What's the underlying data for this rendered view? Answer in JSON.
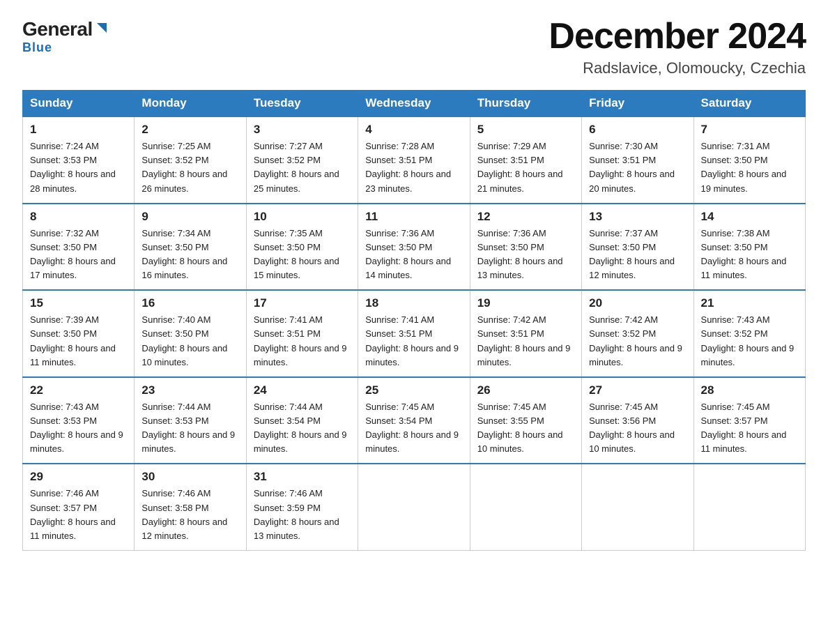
{
  "header": {
    "logo_general": "General",
    "logo_blue": "Blue",
    "month_title": "December 2024",
    "location": "Radslavice, Olomoucky, Czechia"
  },
  "days_of_week": [
    "Sunday",
    "Monday",
    "Tuesday",
    "Wednesday",
    "Thursday",
    "Friday",
    "Saturday"
  ],
  "weeks": [
    [
      {
        "day": "1",
        "sunrise": "7:24 AM",
        "sunset": "3:53 PM",
        "daylight": "8 hours and 28 minutes."
      },
      {
        "day": "2",
        "sunrise": "7:25 AM",
        "sunset": "3:52 PM",
        "daylight": "8 hours and 26 minutes."
      },
      {
        "day": "3",
        "sunrise": "7:27 AM",
        "sunset": "3:52 PM",
        "daylight": "8 hours and 25 minutes."
      },
      {
        "day": "4",
        "sunrise": "7:28 AM",
        "sunset": "3:51 PM",
        "daylight": "8 hours and 23 minutes."
      },
      {
        "day": "5",
        "sunrise": "7:29 AM",
        "sunset": "3:51 PM",
        "daylight": "8 hours and 21 minutes."
      },
      {
        "day": "6",
        "sunrise": "7:30 AM",
        "sunset": "3:51 PM",
        "daylight": "8 hours and 20 minutes."
      },
      {
        "day": "7",
        "sunrise": "7:31 AM",
        "sunset": "3:50 PM",
        "daylight": "8 hours and 19 minutes."
      }
    ],
    [
      {
        "day": "8",
        "sunrise": "7:32 AM",
        "sunset": "3:50 PM",
        "daylight": "8 hours and 17 minutes."
      },
      {
        "day": "9",
        "sunrise": "7:34 AM",
        "sunset": "3:50 PM",
        "daylight": "8 hours and 16 minutes."
      },
      {
        "day": "10",
        "sunrise": "7:35 AM",
        "sunset": "3:50 PM",
        "daylight": "8 hours and 15 minutes."
      },
      {
        "day": "11",
        "sunrise": "7:36 AM",
        "sunset": "3:50 PM",
        "daylight": "8 hours and 14 minutes."
      },
      {
        "day": "12",
        "sunrise": "7:36 AM",
        "sunset": "3:50 PM",
        "daylight": "8 hours and 13 minutes."
      },
      {
        "day": "13",
        "sunrise": "7:37 AM",
        "sunset": "3:50 PM",
        "daylight": "8 hours and 12 minutes."
      },
      {
        "day": "14",
        "sunrise": "7:38 AM",
        "sunset": "3:50 PM",
        "daylight": "8 hours and 11 minutes."
      }
    ],
    [
      {
        "day": "15",
        "sunrise": "7:39 AM",
        "sunset": "3:50 PM",
        "daylight": "8 hours and 11 minutes."
      },
      {
        "day": "16",
        "sunrise": "7:40 AM",
        "sunset": "3:50 PM",
        "daylight": "8 hours and 10 minutes."
      },
      {
        "day": "17",
        "sunrise": "7:41 AM",
        "sunset": "3:51 PM",
        "daylight": "8 hours and 9 minutes."
      },
      {
        "day": "18",
        "sunrise": "7:41 AM",
        "sunset": "3:51 PM",
        "daylight": "8 hours and 9 minutes."
      },
      {
        "day": "19",
        "sunrise": "7:42 AM",
        "sunset": "3:51 PM",
        "daylight": "8 hours and 9 minutes."
      },
      {
        "day": "20",
        "sunrise": "7:42 AM",
        "sunset": "3:52 PM",
        "daylight": "8 hours and 9 minutes."
      },
      {
        "day": "21",
        "sunrise": "7:43 AM",
        "sunset": "3:52 PM",
        "daylight": "8 hours and 9 minutes."
      }
    ],
    [
      {
        "day": "22",
        "sunrise": "7:43 AM",
        "sunset": "3:53 PM",
        "daylight": "8 hours and 9 minutes."
      },
      {
        "day": "23",
        "sunrise": "7:44 AM",
        "sunset": "3:53 PM",
        "daylight": "8 hours and 9 minutes."
      },
      {
        "day": "24",
        "sunrise": "7:44 AM",
        "sunset": "3:54 PM",
        "daylight": "8 hours and 9 minutes."
      },
      {
        "day": "25",
        "sunrise": "7:45 AM",
        "sunset": "3:54 PM",
        "daylight": "8 hours and 9 minutes."
      },
      {
        "day": "26",
        "sunrise": "7:45 AM",
        "sunset": "3:55 PM",
        "daylight": "8 hours and 10 minutes."
      },
      {
        "day": "27",
        "sunrise": "7:45 AM",
        "sunset": "3:56 PM",
        "daylight": "8 hours and 10 minutes."
      },
      {
        "day": "28",
        "sunrise": "7:45 AM",
        "sunset": "3:57 PM",
        "daylight": "8 hours and 11 minutes."
      }
    ],
    [
      {
        "day": "29",
        "sunrise": "7:46 AM",
        "sunset": "3:57 PM",
        "daylight": "8 hours and 11 minutes."
      },
      {
        "day": "30",
        "sunrise": "7:46 AM",
        "sunset": "3:58 PM",
        "daylight": "8 hours and 12 minutes."
      },
      {
        "day": "31",
        "sunrise": "7:46 AM",
        "sunset": "3:59 PM",
        "daylight": "8 hours and 13 minutes."
      },
      null,
      null,
      null,
      null
    ]
  ]
}
